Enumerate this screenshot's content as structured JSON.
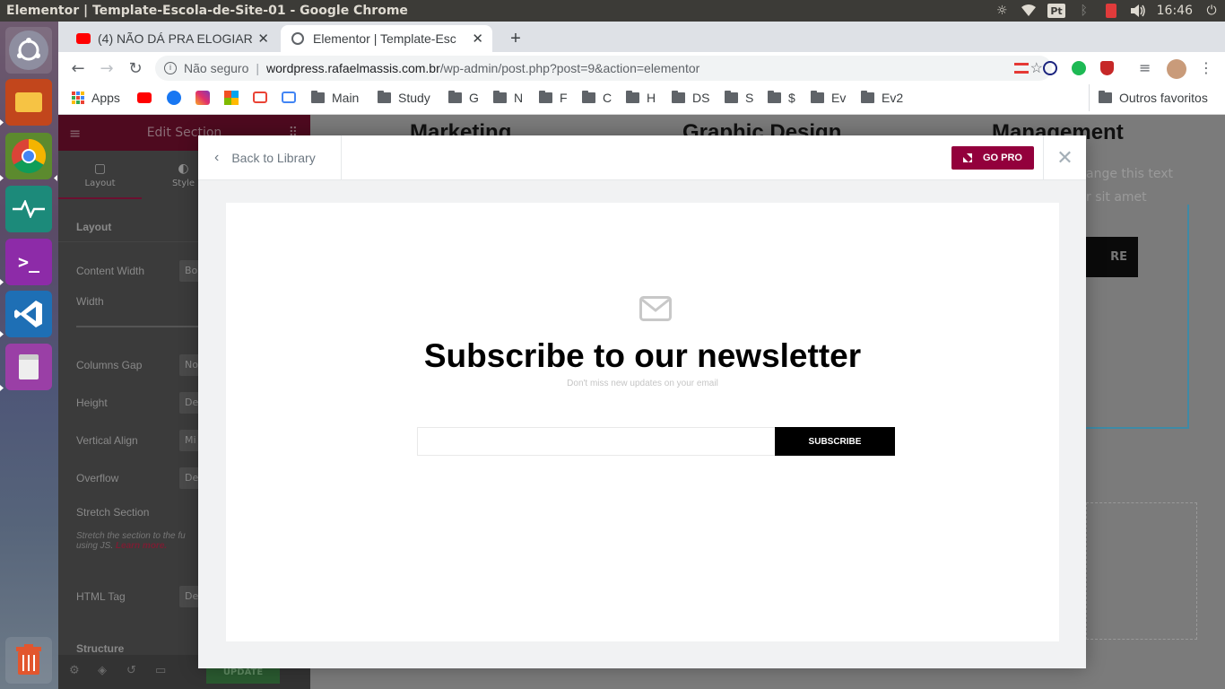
{
  "window": {
    "title": "Elementor | Template-Escola-de-Site-01 - Google Chrome"
  },
  "tray": {
    "pt_label": "Pt",
    "clock": "16:46"
  },
  "tabs": [
    {
      "label": "(4) NÃO DÁ PRA ELOGIAR",
      "active": false
    },
    {
      "label": "Elementor | Template-Esc",
      "active": true
    }
  ],
  "address": {
    "security_label": "Não seguro",
    "host": "wordpress.rafaelmassis.com.br",
    "path": "/wp-admin/post.php?post=9&action=elementor"
  },
  "bookmarks": {
    "apps_label": "Apps",
    "folders": [
      "Main",
      "Study",
      "G",
      "N",
      "F",
      "C",
      "H",
      "DS",
      "S",
      "$",
      "Ev",
      "Ev2"
    ],
    "other_label": "Outros favoritos"
  },
  "editor_sidebar": {
    "header_title": "Edit Section",
    "tabs": [
      "Layout",
      "Style"
    ],
    "section_title": "Layout",
    "rows": [
      {
        "label": "Content Width",
        "value": "Bo"
      },
      {
        "label": "Width",
        "value": ""
      },
      {
        "label": "Columns Gap",
        "value": "No"
      },
      {
        "label": "Height",
        "value": "De"
      },
      {
        "label": "Vertical Align",
        "value": "Mi"
      },
      {
        "label": "Overflow",
        "value": "De"
      },
      {
        "label": "Stretch Section",
        "value": ""
      },
      {
        "label": "HTML Tag",
        "value": "De"
      }
    ],
    "stretch_help": "Stretch the section to the fu using JS.",
    "learn_more": "Learn more.",
    "structure_label": "Structure",
    "update_label": "UPDATE"
  },
  "preview": {
    "columns": [
      "Marketing",
      "Graphic Design",
      "Management"
    ],
    "partial_text_1": "ange this text",
    "partial_text_2": "r sit amet",
    "partial_button": "RE"
  },
  "modal": {
    "back_label": "Back to Library",
    "gopro_label": "GO PRO",
    "newsletter": {
      "title": "Subscribe to our newsletter",
      "subtitle": "Don't miss new updates on your email",
      "input_placeholder": "",
      "button_label": "SUBSCRIBE"
    }
  },
  "colors": {
    "accent": "#93003c",
    "chrome_bg": "#dee1e6",
    "launcher": "#5b4a66"
  }
}
